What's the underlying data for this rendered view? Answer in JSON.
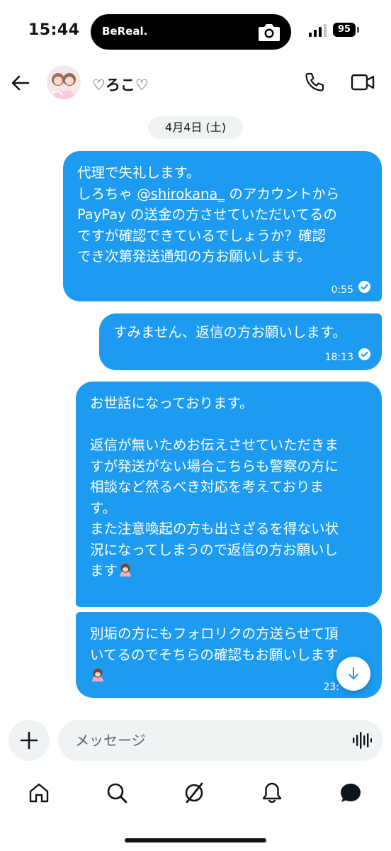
{
  "status_bar": {
    "time": "15:44",
    "island_label": "BeReal.",
    "battery": "95"
  },
  "header": {
    "contact_name": "♡ろこ♡"
  },
  "conversation": {
    "date_label": "4月4日 (土)",
    "messages": [
      {
        "line1": "代理で失礼します。",
        "line2_before": "しろちゃ ",
        "mention": "@shirokana_",
        "line2_after": " のアカウントから",
        "rest": "PayPay の送金の方させていただいてるの\nですが確認できているでしょうか？確認\nでき次第発送通知の方お願いします。",
        "time": "0:55"
      },
      {
        "text": "すみません、返信の方お願いします。",
        "time": "18:13"
      },
      {
        "text": "お世話になっております。\n\n返信が無いためお伝えさせていただきま\nすが発送がない場合こちらも警察の方に\n相談など然るべき対応を考えておりま\nす。\nまた注意喚起の方も出さざるを得ない状\n況になってしまうので返信の方お願いし\nます"
      },
      {
        "text": "別垢の方にもフォロリクの方送らせて頂\nいてるのでそちらの確認もお願いします",
        "time": "23:"
      }
    ]
  },
  "composer": {
    "placeholder": "メッセージ"
  },
  "nav": {
    "items": [
      "home-icon",
      "search-icon",
      "grok-icon",
      "notifications-icon",
      "messages-icon"
    ]
  },
  "colors": {
    "bubble": "#1d9bf0",
    "input_bg": "#eff3f4",
    "text": "#0f1419"
  }
}
